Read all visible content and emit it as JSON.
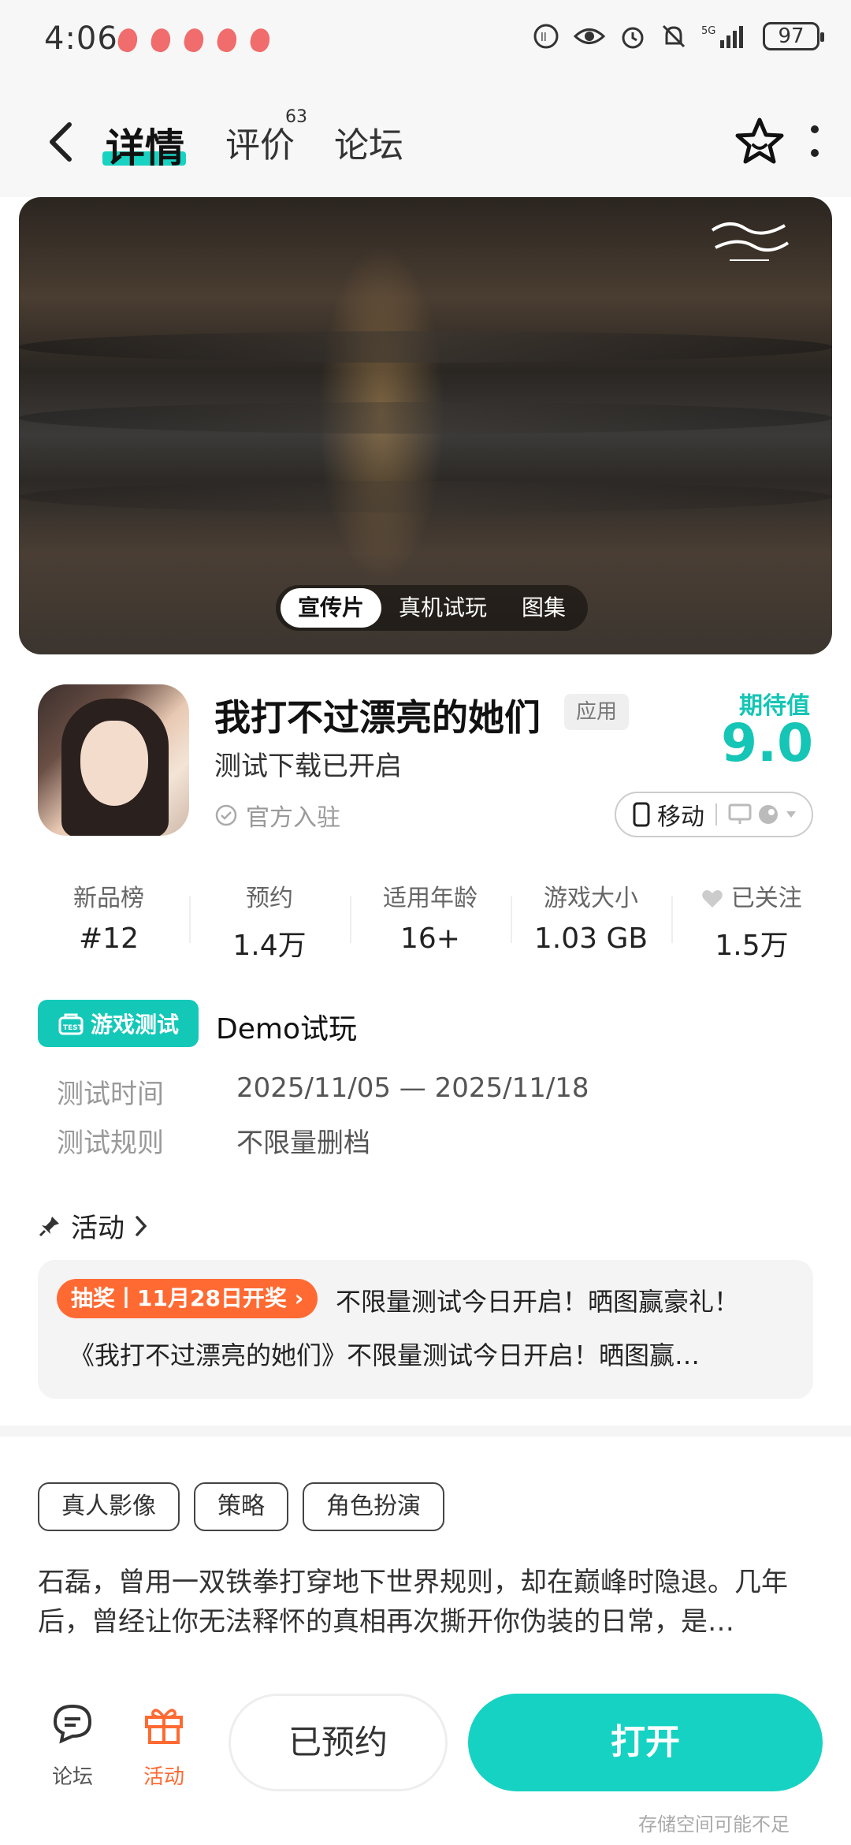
{
  "status_bar": {
    "time": "4:06",
    "battery": "97"
  },
  "nav": {
    "tabs": [
      {
        "label": "详情"
      },
      {
        "label": "评价"
      },
      {
        "label": "论坛"
      }
    ],
    "review_count": "63"
  },
  "hero": {
    "tabs": [
      "宣传片",
      "真机试玩",
      "图集"
    ],
    "active_tab": "宣传片"
  },
  "app": {
    "title": "我打不过漂亮的她们",
    "type_tag": "应用",
    "subtitle": "测试下载已开启",
    "official": "官方入驻",
    "expect_label": "期待值",
    "expect_value": "9.0",
    "platform": "移动"
  },
  "stats": [
    {
      "label": "新品榜",
      "value": "#12"
    },
    {
      "label": "预约",
      "value": "1.4万"
    },
    {
      "label": "适用年龄",
      "value": "16+"
    },
    {
      "label": "游戏大小",
      "value": "1.03 GB"
    },
    {
      "label": "已关注",
      "value": "1.5万"
    }
  ],
  "test": {
    "badge": "游戏测试",
    "title": "Demo试玩",
    "rows": [
      {
        "label": "测试时间",
        "value": "2025/11/05 — 2025/11/18"
      },
      {
        "label": "测试规则",
        "value": "不限量删档"
      }
    ]
  },
  "activity": {
    "header": "活动",
    "tag": "抽奖丨11月28日开奖",
    "line1": "不限量测试今日开启！晒图赢豪礼！",
    "line2": "《我打不过漂亮的她们》不限量测试今日开启！晒图赢…"
  },
  "tags": [
    "真人影像",
    "策略",
    "角色扮演"
  ],
  "description": "石磊，曾用一双铁拳打穿地下世界规则，却在巅峰时隐退。几年后，曾经让你无法释怀的真相再次撕开你伪装的日常，是…",
  "bottom": {
    "forum": "论坛",
    "activity": "活动",
    "reserved": "已预约",
    "open": "打开",
    "storage_hint": "存储空间可能不足"
  },
  "colors": {
    "accent": "#16d2c3",
    "orange": "#ff6a33"
  }
}
